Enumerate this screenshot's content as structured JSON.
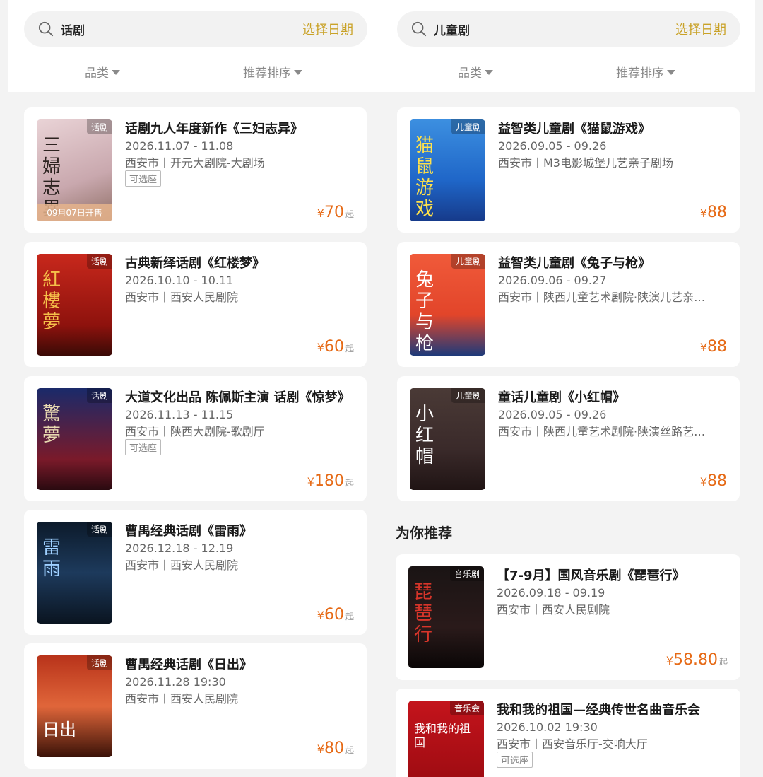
{
  "left": {
    "search": {
      "query": "话剧",
      "date_label": "选择日期"
    },
    "filters": {
      "category": "品类",
      "sort": "推荐排序"
    },
    "items": [
      {
        "tag": "话剧",
        "poster_text": "三婦志異",
        "sale_note": "09月07日开售",
        "title": "话剧九人年度新作《三妇志异》",
        "date": "2026.11.07 - 11.08",
        "venue": "西安市丨开元大剧院-大剧场",
        "seat": "可选座",
        "price_yen": "¥",
        "price_num": "70",
        "price_suffix": "起"
      },
      {
        "tag": "话剧",
        "poster_text": "紅樓夢",
        "title": "古典新绎话剧《红楼梦》",
        "date": "2026.10.10 - 10.11",
        "venue": "西安市丨西安人民剧院",
        "price_yen": "¥",
        "price_num": "60",
        "price_suffix": "起"
      },
      {
        "tag": "话剧",
        "poster_text": "驚夢",
        "title": "大道文化出品 陈佩斯主演 话剧《惊梦》",
        "date": "2026.11.13 - 11.15",
        "venue": "西安市丨陕西大剧院-歌剧厅",
        "seat": "可选座",
        "price_yen": "¥",
        "price_num": "180",
        "price_suffix": "起"
      },
      {
        "tag": "话剧",
        "poster_text": "雷雨",
        "title": "曹禺经典话剧《雷雨》",
        "date": "2026.12.18 - 12.19",
        "venue": "西安市丨西安人民剧院",
        "price_yen": "¥",
        "price_num": "60",
        "price_suffix": "起"
      },
      {
        "tag": "话剧",
        "poster_text": "日出",
        "title": "曹禺经典话剧《日出》",
        "date": "2026.11.28 19:30",
        "venue": "西安市丨西安人民剧院",
        "price_yen": "¥",
        "price_num": "80",
        "price_suffix": "起"
      }
    ]
  },
  "right": {
    "search": {
      "query": "儿童剧",
      "date_label": "选择日期"
    },
    "filters": {
      "category": "品类",
      "sort": "推荐排序"
    },
    "items": [
      {
        "tag": "儿童剧",
        "poster_text": "猫鼠游戏",
        "title": "益智类儿童剧《猫鼠游戏》",
        "date": "2026.09.05 - 09.26",
        "venue": "西安市丨M3电影城堡儿艺亲子剧场",
        "price_yen": "¥",
        "price_num": "88"
      },
      {
        "tag": "儿童剧",
        "poster_text": "兔子与枪",
        "title": "益智类儿童剧《兔子与枪》",
        "date": "2026.09.06 - 09.27",
        "venue": "西安市丨陕西儿童艺术剧院·陕演儿艺亲…",
        "price_yen": "¥",
        "price_num": "88"
      },
      {
        "tag": "儿童剧",
        "poster_text": "小红帽",
        "title": "童话儿童剧《小红帽》",
        "date": "2026.09.05 - 09.26",
        "venue": "西安市丨陕西儿童艺术剧院·陕演丝路艺…",
        "price_yen": "¥",
        "price_num": "88"
      }
    ],
    "recommend_title": "为你推荐",
    "recommend": [
      {
        "tag": "音乐剧",
        "poster_text": "琵琶行",
        "title": "【7-9月】国风音乐剧《琵琶行》",
        "date": "2026.09.18 - 09.19",
        "venue": "西安市丨西安人民剧院",
        "price_yen": "¥",
        "price_num": "58.80",
        "price_suffix": "起"
      },
      {
        "tag": "音乐会",
        "poster_text": "我和我的祖国",
        "title": "我和我的祖国—经典传世名曲音乐会",
        "date": "2026.10.02 19:30",
        "venue": "西安市丨西安音乐厅-交响大厅",
        "seat": "可选座"
      }
    ]
  },
  "colors": {
    "accent_gold": "#c9a227",
    "price_orange": "#e66a16"
  }
}
